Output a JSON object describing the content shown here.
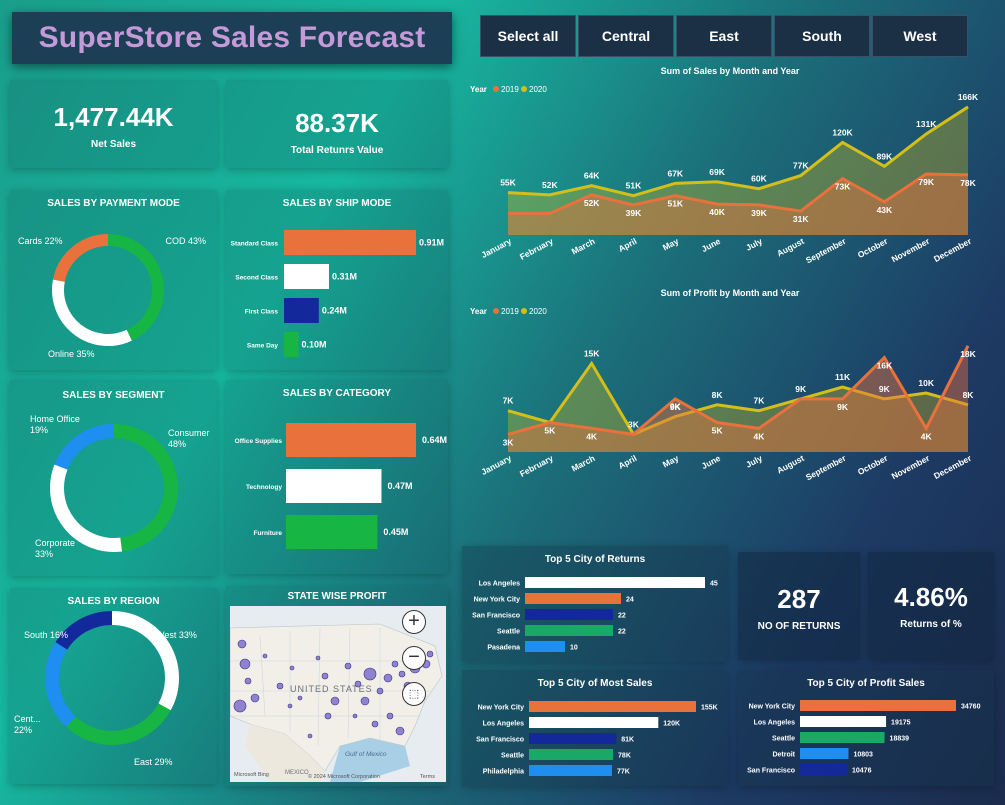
{
  "header": {
    "title": "SuperStore Sales Forecast"
  },
  "slicer": [
    "Select all",
    "Central",
    "East",
    "South",
    "West"
  ],
  "kpis": {
    "net_sales": {
      "value": "1,477.44K",
      "label": "Net Sales"
    },
    "returns_value": {
      "value": "88.37K",
      "label": "Total Retunrs Value"
    },
    "no_of_returns": {
      "value": "287",
      "label": "NO OF RETURNS"
    },
    "returns_pct": {
      "value": "4.86%",
      "label": "Returns of %"
    }
  },
  "colors": {
    "orange": "#e8713c",
    "white": "#ffffff",
    "navy": "#13289a",
    "green": "#17b644",
    "blue": "#1f8ef1",
    "gold": "#d4be1a",
    "teal": "#1aa866"
  },
  "map": {
    "title": "STATE WISE PROFIT",
    "country_label": "UNITED STATES",
    "gulf_label": "Gulf of Mexico",
    "mexico_label": "MEXICO",
    "credit": "© 2024 Microsoft Corporation",
    "terms": "Terms",
    "brand": "Microsoft Bing"
  },
  "chart_data": [
    {
      "type": "pie",
      "title": "SALES BY PAYMENT MODE",
      "categories": [
        "COD",
        "Online",
        "Cards"
      ],
      "values": [
        43,
        35,
        22
      ],
      "labels": [
        "COD 43%",
        "Online 35%",
        "Cards 22%"
      ],
      "colors": [
        "#17b644",
        "#ffffff",
        "#e8713c"
      ]
    },
    {
      "type": "bar",
      "title": "SALES BY SHIP MODE",
      "categories": [
        "Standard Class",
        "Second Class",
        "First Class",
        "Same Day"
      ],
      "values": [
        0.91,
        0.31,
        0.24,
        0.1
      ],
      "labels": [
        "0.91M",
        "0.31M",
        "0.24M",
        "0.10M"
      ],
      "colors": [
        "#e8713c",
        "#ffffff",
        "#13289a",
        "#17b644"
      ]
    },
    {
      "type": "pie",
      "title": "SALES BY SEGMENT",
      "categories": [
        "Consumer",
        "Corporate",
        "Home Office"
      ],
      "values": [
        48,
        33,
        19
      ],
      "labels": [
        "Consumer 48%",
        "Corporate 33%",
        "Home Office 19%"
      ],
      "colors": [
        "#17b644",
        "#ffffff",
        "#1f8ef1"
      ]
    },
    {
      "type": "bar",
      "title": "SALES BY CATEGORY",
      "categories": [
        "Office Supplies",
        "Technology",
        "Furniture"
      ],
      "values": [
        0.64,
        0.47,
        0.45
      ],
      "labels": [
        "0.64M",
        "0.47M",
        "0.45M"
      ],
      "colors": [
        "#e8713c",
        "#ffffff",
        "#17b644"
      ]
    },
    {
      "type": "pie",
      "title": "SALES BY REGION",
      "categories": [
        "West",
        "East",
        "Central",
        "South"
      ],
      "values": [
        33,
        29,
        22,
        16
      ],
      "labels": [
        "West 33%",
        "East 29%",
        "Cent... 22%",
        "South 16%"
      ],
      "colors": [
        "#ffffff",
        "#17b644",
        "#1f8ef1",
        "#13289a"
      ]
    },
    {
      "type": "area",
      "title": "Sum of Sales by Month and Year",
      "legend_title": "Year",
      "x": [
        "January",
        "February",
        "March",
        "April",
        "May",
        "June",
        "July",
        "August",
        "September",
        "October",
        "November",
        "December"
      ],
      "series": [
        {
          "name": "2019",
          "values": [
            28,
            28,
            52,
            39,
            51,
            40,
            39,
            31,
            73,
            43,
            79,
            78
          ],
          "labels": [
            "",
            "",
            "52K",
            "39K",
            "51K",
            "40K",
            "39K",
            "31K",
            "73K",
            "43K",
            "79K",
            "78K"
          ]
        },
        {
          "name": "2020",
          "values": [
            55,
            52,
            64,
            51,
            67,
            69,
            60,
            77,
            120,
            89,
            131,
            166
          ],
          "labels": [
            "55K",
            "52K",
            "64K",
            "51K",
            "67K",
            "69K",
            "60K",
            "77K",
            "120K",
            "89K",
            "131K",
            "166K"
          ]
        }
      ]
    },
    {
      "type": "area",
      "title": "Sum of Profit by Month and Year",
      "legend_title": "Year",
      "x": [
        "January",
        "February",
        "March",
        "April",
        "May",
        "June",
        "July",
        "August",
        "September",
        "October",
        "November",
        "December"
      ],
      "series": [
        {
          "name": "2019",
          "values": [
            3,
            5,
            4,
            3,
            9,
            5,
            4,
            9,
            9,
            16,
            4,
            18
          ],
          "labels": [
            "3K",
            "5K",
            "4K",
            "",
            "9K",
            "5K",
            "4K",
            "",
            "9K",
            "16K",
            "4K",
            "18K"
          ]
        },
        {
          "name": "2020",
          "values": [
            7,
            5,
            15,
            3,
            6,
            8,
            7,
            9,
            11,
            9,
            10,
            8
          ],
          "labels": [
            "7K",
            "",
            "15K",
            "3K",
            "6K",
            "8K",
            "7K",
            "9K",
            "11K",
            "9K",
            "10K",
            "8K"
          ]
        }
      ]
    },
    {
      "type": "bar",
      "title": "Top 5 City of Returns",
      "categories": [
        "Los Angeles",
        "New York City",
        "San Francisco",
        "Seattle",
        "Pasadena"
      ],
      "values": [
        45,
        24,
        22,
        22,
        10
      ],
      "labels": [
        "45",
        "24",
        "22",
        "22",
        "10"
      ],
      "colors": [
        "#ffffff",
        "#e8713c",
        "#13289a",
        "#1aa866",
        "#1f8ef1"
      ]
    },
    {
      "type": "bar",
      "title": "Top 5 City of Most Sales",
      "categories": [
        "New York City",
        "Los Angeles",
        "San Francisco",
        "Seattle",
        "Philadelphia"
      ],
      "values": [
        155,
        120,
        81,
        78,
        77
      ],
      "labels": [
        "155K",
        "120K",
        "81K",
        "78K",
        "77K"
      ],
      "colors": [
        "#e8713c",
        "#ffffff",
        "#13289a",
        "#1aa866",
        "#1f8ef1"
      ]
    },
    {
      "type": "bar",
      "title": "Top 5 City of Profit Sales",
      "categories": [
        "New York City",
        "Los Angeles",
        "Seattle",
        "Detroit",
        "San Francisco"
      ],
      "values": [
        34760,
        19175,
        18839,
        10803,
        10476
      ],
      "labels": [
        "34760",
        "19175",
        "18839",
        "10803",
        "10476"
      ],
      "colors": [
        "#e8713c",
        "#ffffff",
        "#1aa866",
        "#1f8ef1",
        "#13289a"
      ]
    }
  ]
}
